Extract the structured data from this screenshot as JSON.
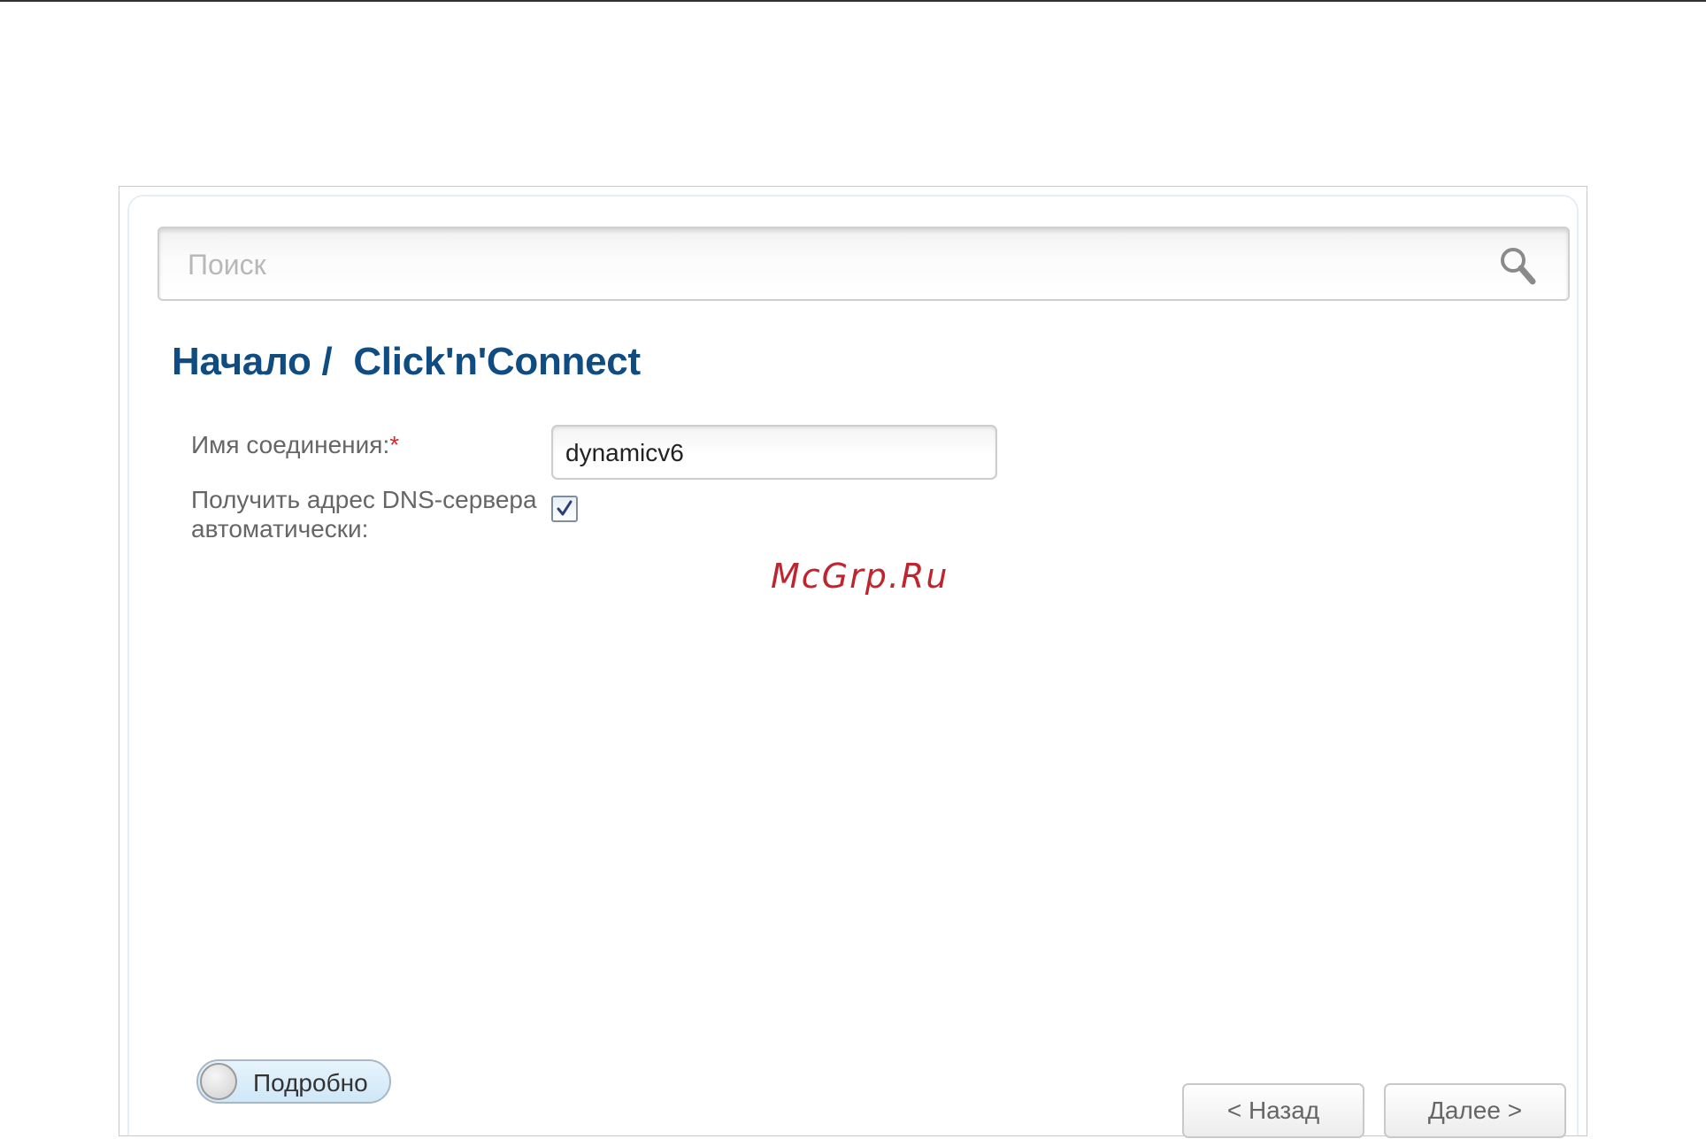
{
  "search": {
    "placeholder": "Поиск",
    "value": ""
  },
  "breadcrumb": {
    "home": "Начало",
    "separator": " /  ",
    "current": "Click'n'Connect"
  },
  "form": {
    "connection_name_label": "Имя соединения:",
    "required_mark": "*",
    "connection_name_value": "dynamicv6",
    "dns_auto_label": "Получить адрес DNS-сервера автоматически:",
    "dns_auto_checked": true
  },
  "watermark": "McGrp.Ru",
  "details_toggle": {
    "label": "Подробно",
    "on": false
  },
  "buttons": {
    "back": "< Назад",
    "next": "Далее >"
  },
  "colors": {
    "title": "#0f4c81",
    "required": "#e0262d",
    "watermark": "#c0242e"
  },
  "icons": {
    "search": "magnifier-icon",
    "check": "checkmark-icon"
  }
}
